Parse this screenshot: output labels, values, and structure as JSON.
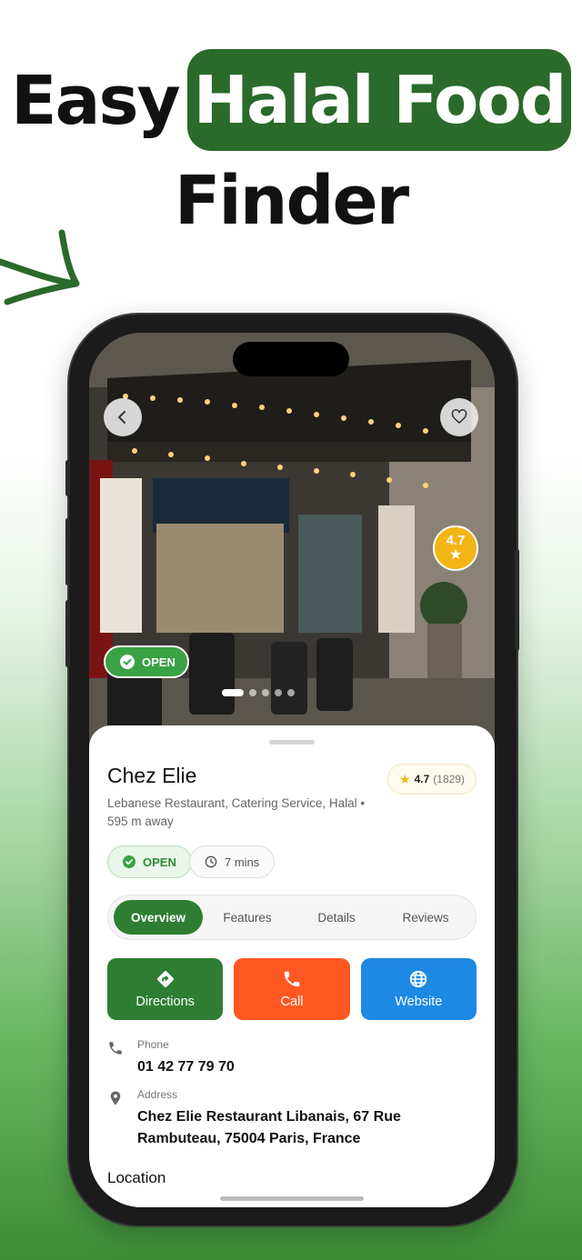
{
  "headline": {
    "word1": "Easy",
    "highlight": "Halal Food",
    "word2": "Finder"
  },
  "colors": {
    "brand_green": "#2e7d32",
    "call_orange": "#ff5722",
    "website_blue": "#1e88e5",
    "rating_gold": "#f3b416"
  },
  "hero": {
    "back_icon": "chevron-left-icon",
    "favorite_icon": "heart-icon",
    "rating": "4.7",
    "open_label": "OPEN",
    "carousel_pages": 5,
    "carousel_active": 1
  },
  "place": {
    "name": "Chez Elie",
    "rating": "4.7",
    "review_count": "(1829)",
    "description": "Lebanese Restaurant, Catering Service, Halal • 595 m away",
    "status": "OPEN",
    "travel_time": "7 mins"
  },
  "tabs": [
    {
      "label": "Overview",
      "active": true
    },
    {
      "label": "Features",
      "active": false
    },
    {
      "label": "Details",
      "active": false
    },
    {
      "label": "Reviews",
      "active": false
    }
  ],
  "actions": {
    "directions": "Directions",
    "call": "Call",
    "website": "Website"
  },
  "contact": {
    "phone_label": "Phone",
    "phone_value": "01 42 77 79 70",
    "address_label": "Address",
    "address_value": "Chez Elie Restaurant Libanais, 67 Rue Rambuteau, 75004 Paris, France"
  },
  "location_title": "Location"
}
